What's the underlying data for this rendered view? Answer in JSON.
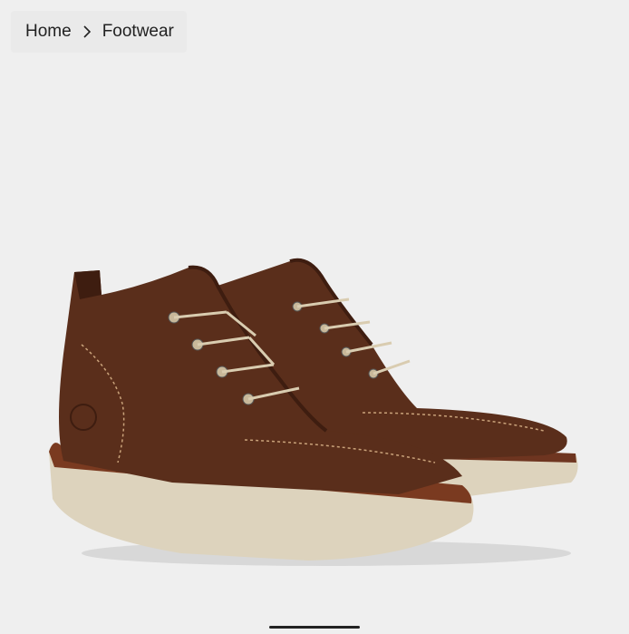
{
  "breadcrumb": {
    "home_label": "Home",
    "separator_icon": "chevron-right-icon",
    "current_label": "Footwear"
  },
  "product": {
    "image_icon": "boot-image",
    "colors": {
      "leather": "#5a2e1b",
      "leather_dark": "#3e1d10",
      "sole": "#ddd3bd",
      "welt": "#7a3a20",
      "laces": "#d9ccb0"
    }
  },
  "pager": {
    "indicator": "scroll-indicator"
  }
}
